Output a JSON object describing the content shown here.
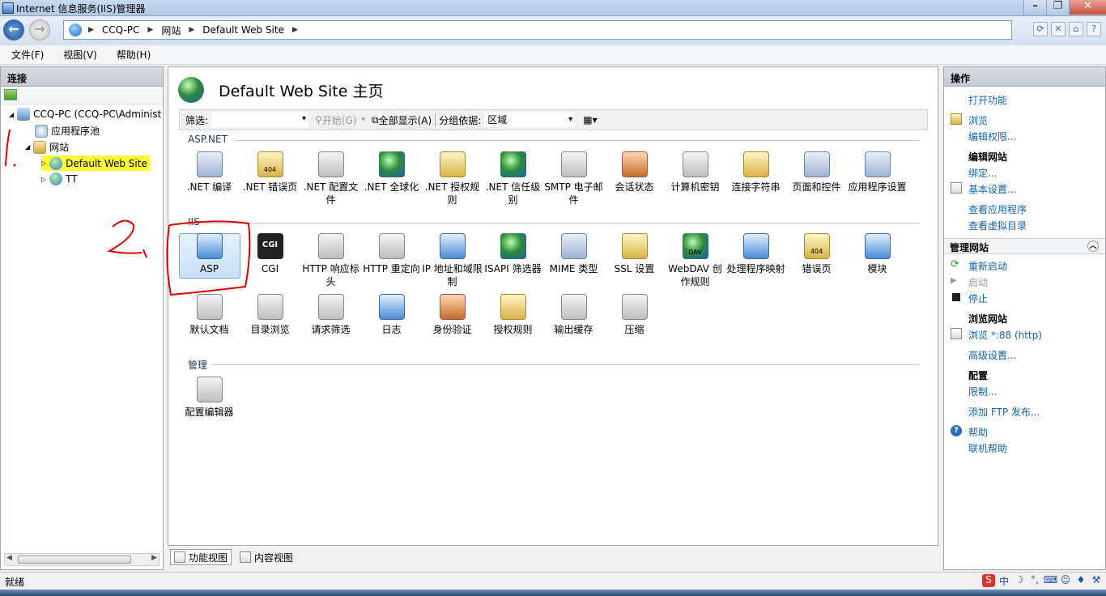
{
  "window": {
    "title": "Internet 信息服务(IIS)管理器"
  },
  "address": {
    "parts": [
      "CCQ-PC",
      "网站",
      "Default Web Site"
    ]
  },
  "menu": [
    "文件(F)",
    "视图(V)",
    "帮助(H)"
  ],
  "connections": {
    "header": "连接",
    "tree": {
      "server": "CCQ-PC (CCQ-PC\\Administ",
      "app_pools": "应用程序池",
      "sites": "网站",
      "selected_site": "Default Web Site",
      "other_site": "TT"
    }
  },
  "main": {
    "title": "Default Web Site 主页",
    "filter": {
      "label": "筛选:",
      "start": "开始(G)",
      "show_all": "全部显示(A)",
      "group_label": "分组依据:",
      "group_value": "区域"
    },
    "sections": {
      "aspnet": "ASP.NET",
      "iis": "IIS",
      "manage": "管理"
    },
    "aspnet_features": [
      ".NET 编译",
      ".NET 错误页",
      ".NET 配置文件",
      ".NET 全球化",
      ".NET 授权规则",
      ".NET 信任级别",
      "SMTP 电子邮件",
      "会话状态",
      "计算机密钥",
      "连接字符串",
      "页面和控件",
      "应用程序设置"
    ],
    "iis_features_row1": [
      "ASP",
      "CGI",
      "HTTP 响应标头",
      "HTTP 重定向",
      "IP 地址和域限制",
      "ISAPI 筛选器",
      "MIME 类型",
      "SSL 设置",
      "WebDAV 创作规则",
      "处理程序映射",
      "错误页",
      "模块"
    ],
    "iis_features_row2": [
      "默认文档",
      "目录浏览",
      "请求筛选",
      "日志",
      "身份验证",
      "授权规则",
      "输出缓存",
      "压缩"
    ],
    "manage_features": [
      "配置编辑器"
    ],
    "icon_texts": {
      "cgi": "CGI",
      "error_page": "404",
      "webdav": "DAV"
    }
  },
  "bottom_tabs": {
    "features": "功能视图",
    "content": "内容视图"
  },
  "actions": {
    "header": "操作",
    "open_feature": "打开功能",
    "browse": "浏览",
    "edit_permissions": "编辑权限...",
    "edit_site": "编辑网站",
    "bindings": "绑定...",
    "basic_settings": "基本设置...",
    "view_apps": "查看应用程序",
    "view_vdirs": "查看虚拟目录",
    "manage_site": "管理网站",
    "restart": "重新启动",
    "start": "启动",
    "stop": "停止",
    "browse_site": "浏览网站",
    "browse_88": "浏览 *:88 (http)",
    "advanced": "高级设置...",
    "config": "配置",
    "limits": "限制...",
    "add_ftp": "添加 FTP 发布...",
    "help": "帮助",
    "online_help": "联机帮助"
  },
  "status": {
    "text": "就绪"
  },
  "annotations": {
    "one": "1.",
    "two": "2."
  },
  "colors": {
    "link": "#1664b4",
    "highlight": "#ffff33",
    "annotation": "#e00000"
  }
}
